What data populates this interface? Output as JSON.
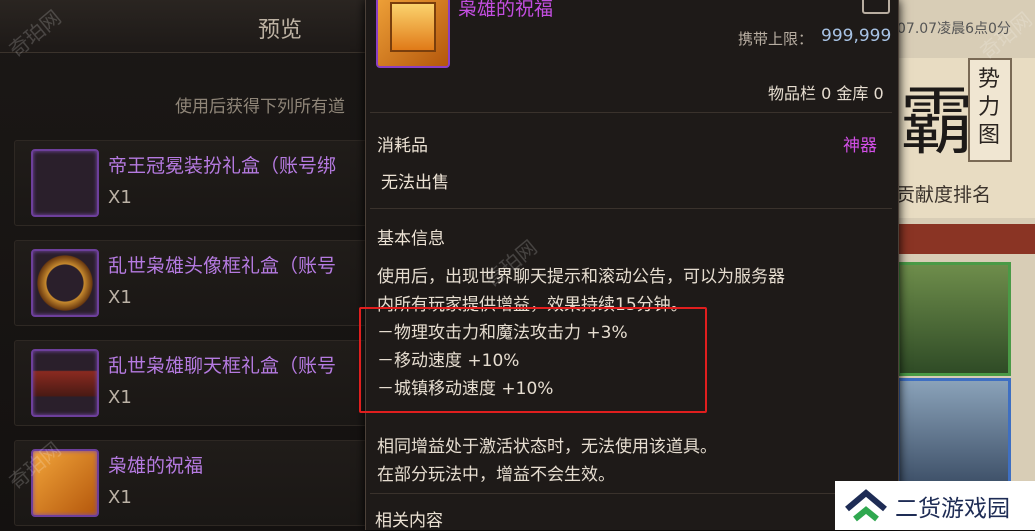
{
  "left_panel": {
    "title": "预览",
    "subtitle": "使用后获得下列所有道",
    "rewards": [
      {
        "name": "帝王冠冕装扮礼盒（账号绑",
        "qty": "X1"
      },
      {
        "name": "乱世枭雄头像框礼盒（账号",
        "qty": "X1"
      },
      {
        "name": "乱世枭雄聊天框礼盒（账号",
        "qty": "X1"
      },
      {
        "name": "枭雄的祝福",
        "qty": "X1"
      }
    ]
  },
  "background_right": {
    "top_text": "07.07凌晨6点0分",
    "banner_big": "霸",
    "banner_vertical": "势力图",
    "rank_label": "贡献度排名"
  },
  "tooltip": {
    "item_name": "枭雄的祝福",
    "carry_limit_label": "携带上限：",
    "carry_limit_value": "999,999",
    "storage": "物品栏 0 金库 0",
    "category": "消耗品",
    "rarity": "神器",
    "sell_status": "无法出售",
    "basic_info_header": "基本信息",
    "description_lines": [
      "使用后，出现世界聊天提示和滚动公告，可以为服务器",
      "内所有玩家提供增益，效果持续15分钟。"
    ],
    "buff_lines": [
      "－物理攻击力和魔法攻击力 +3%",
      "－移动速度 +10%",
      "－城镇移动速度 +10%"
    ],
    "note_lines": [
      "相同增益处于激活状态时，无法使用该道具。",
      "在部分玩法中，增益不会生效。"
    ],
    "related_header": "相关内容"
  },
  "watermarks": [
    "奇珀网",
    "奇珀网",
    "奇珀网",
    "奇珀网"
  ],
  "logo": {
    "text": "二货游戏园"
  },
  "colors": {
    "rarity_purple": "#c34ee0",
    "highlight_red": "#e01e1e",
    "limit_blue": "#a8c3e5"
  }
}
